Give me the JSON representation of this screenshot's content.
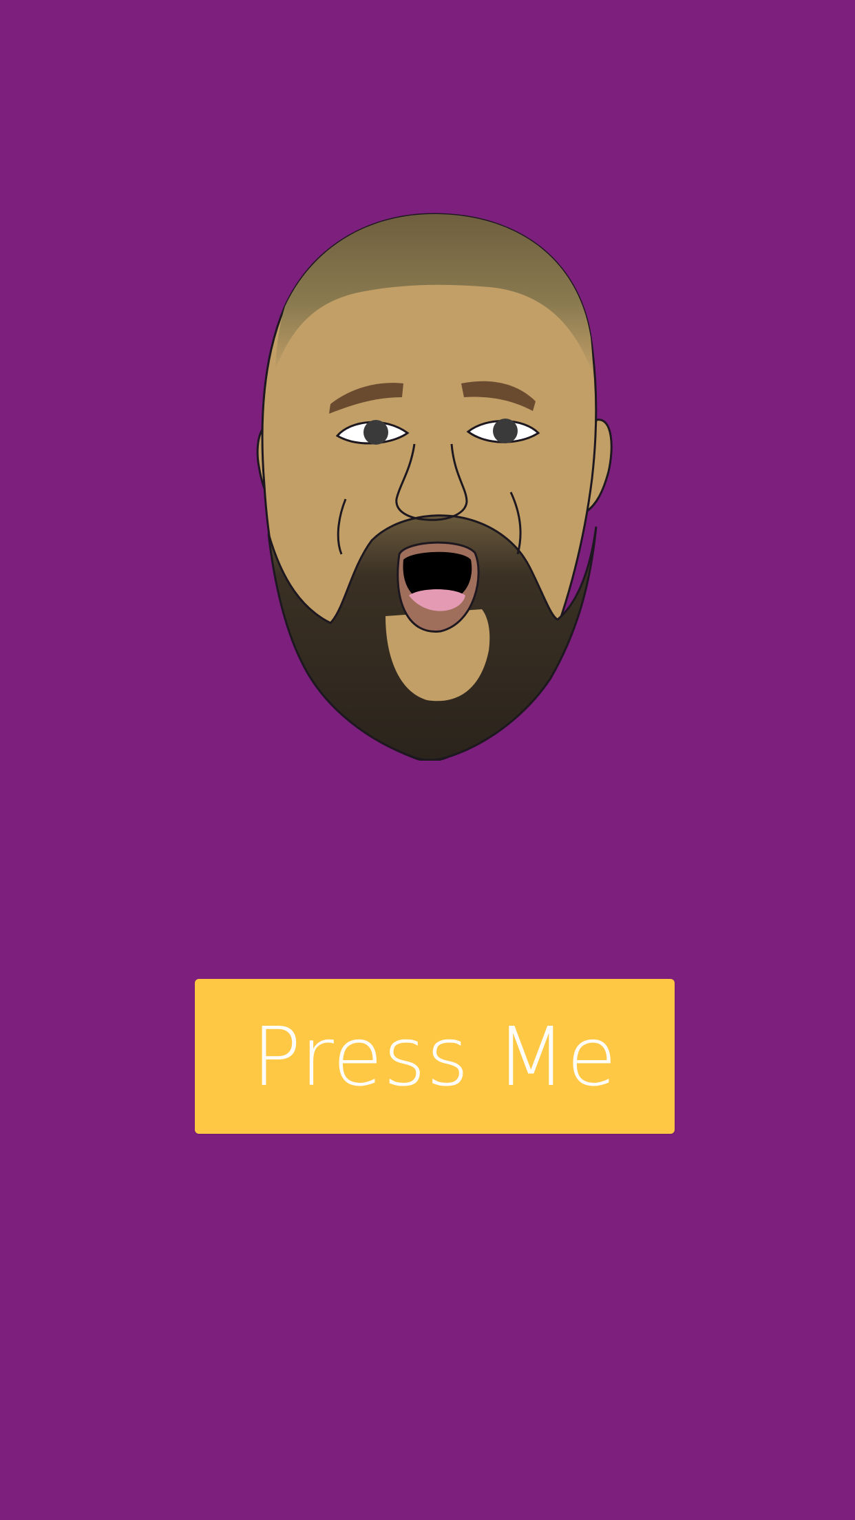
{
  "colors": {
    "background": "#7d1f7d",
    "button": "#ffc844",
    "button_text": "#ffffff",
    "skin": "#c19f67",
    "beard": "#2b241c"
  },
  "hero": {
    "icon": "cartoon-face-illustration"
  },
  "action": {
    "button_label": "Press Me"
  }
}
